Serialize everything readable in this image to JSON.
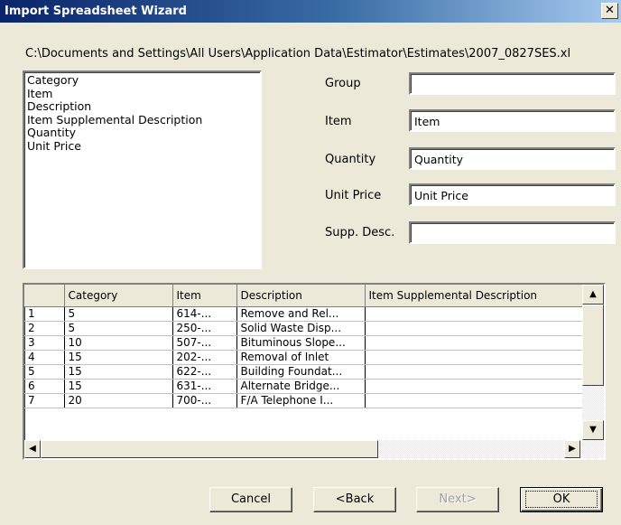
{
  "window": {
    "title": "Import Spreadsheet Wizard",
    "close_glyph": "✕"
  },
  "file_path": "C:\\Documents and Settings\\All Users\\Application Data\\Estimator\\Estimates\\2007_0827SES.xl",
  "available_fields": [
    "Category",
    "Item",
    "Description",
    "Item Supplemental Description",
    "Quantity",
    "Unit Price"
  ],
  "mapping": {
    "group": {
      "label": "Group",
      "value": ""
    },
    "item": {
      "label": "Item",
      "value": "Item"
    },
    "quantity": {
      "label": "Quantity",
      "value": "Quantity"
    },
    "unit_price": {
      "label": "Unit Price",
      "value": "Unit Price"
    },
    "supp_desc": {
      "label": "Supp. Desc.",
      "value": ""
    }
  },
  "grid": {
    "columns": [
      "",
      "Category",
      "Item",
      "Description",
      "Item Supplemental Description"
    ],
    "rows": [
      {
        "num": "1",
        "category": "5",
        "item": "614-...",
        "description": "Remove and Rel...",
        "supp": ""
      },
      {
        "num": "2",
        "category": "5",
        "item": "250-...",
        "description": "Solid Waste Disp...",
        "supp": ""
      },
      {
        "num": "3",
        "category": "10",
        "item": "507-...",
        "description": "Bituminous Slope...",
        "supp": ""
      },
      {
        "num": "4",
        "category": "15",
        "item": "202-...",
        "description": "Removal of Inlet",
        "supp": ""
      },
      {
        "num": "5",
        "category": "15",
        "item": "622-...",
        "description": "Building Foundat...",
        "supp": ""
      },
      {
        "num": "6",
        "category": "15",
        "item": "631-...",
        "description": "Alternate Bridge...",
        "supp": ""
      },
      {
        "num": "7",
        "category": "20",
        "item": "700-...",
        "description": "F/A Telephone I...",
        "supp": ""
      }
    ]
  },
  "buttons": {
    "cancel": "Cancel",
    "back": "<Back",
    "next": "Next>",
    "ok": "OK"
  },
  "icons": {
    "scroll_up": "▲",
    "scroll_down": "▼",
    "scroll_left": "◀",
    "scroll_right": "▶"
  }
}
